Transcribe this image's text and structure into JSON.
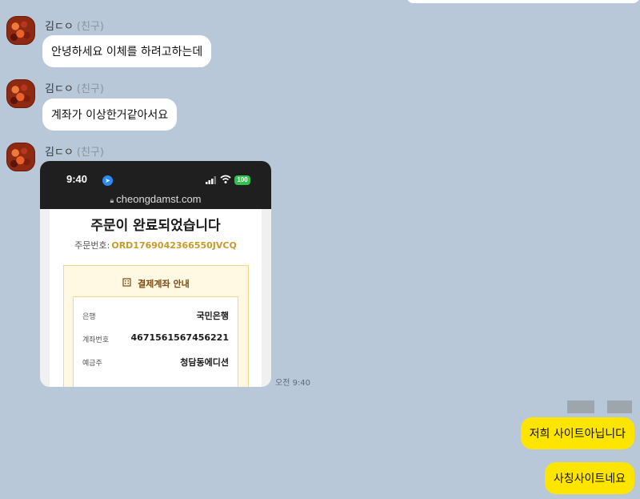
{
  "chat": {
    "incoming": [
      {
        "sender": "김ㄷㅇ",
        "relation": "(친구)",
        "text": "안녕하세요 이체를 하려고하는데"
      },
      {
        "sender": "김ㄷㅇ",
        "relation": "(친구)",
        "text": "계좌가 이상한거같아서요"
      },
      {
        "sender": "김ㄷㅇ",
        "relation": "(친구)",
        "time": "오전 9:40"
      }
    ],
    "outgoing": [
      {
        "text": "저희 사이트아닙니다"
      },
      {
        "text": "사칭사이트네요"
      }
    ]
  },
  "screenshot": {
    "status_time": "9:40",
    "battery": "100",
    "url": "cheongdamst.com",
    "title": "주문이 완료되었습니다",
    "order_label": "주문번호:",
    "order_number": "ORD1769042366550JVCQ",
    "payment_title": "결제계좌 안내",
    "rows": [
      {
        "label": "은행",
        "value": "국민은행"
      },
      {
        "label": "계좌번호",
        "value": "4671561567456221"
      },
      {
        "label": "예금주",
        "value": "청담동에디션"
      }
    ]
  },
  "icons": {
    "location": "location-arrow-icon",
    "signal": "cell-signal-icon",
    "wifi": "wifi-icon",
    "lock": "lock-icon",
    "bank": "bank-building-icon"
  },
  "colors": {
    "background": "#b9c8d9",
    "my_bubble": "#fee500",
    "their_bubble": "#ffffff",
    "order_code": "#c79a2a",
    "battery": "#30c24a"
  }
}
